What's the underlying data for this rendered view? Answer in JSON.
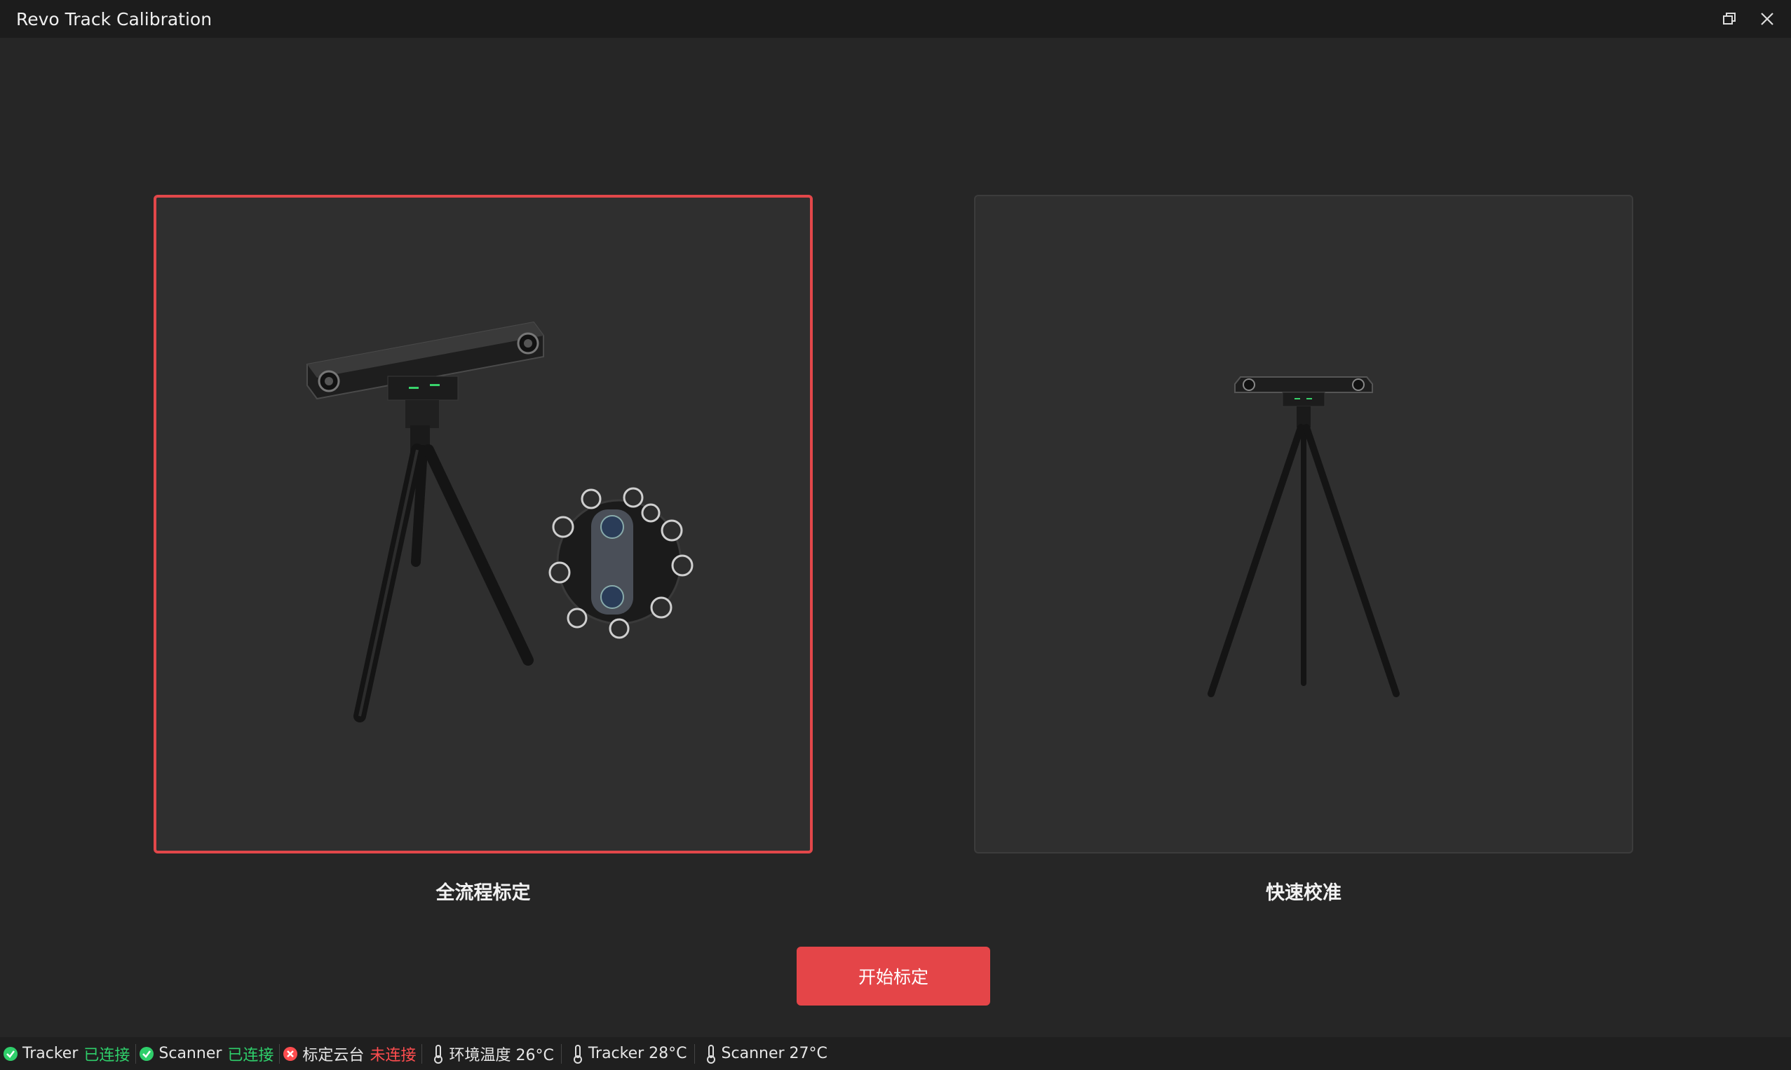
{
  "window": {
    "title": "Revo Track Calibration",
    "restore_icon": "restore-icon",
    "close_icon": "close-icon"
  },
  "cards": [
    {
      "label": "全流程标定",
      "selected": true
    },
    {
      "label": "快速校准",
      "selected": false
    }
  ],
  "start_button": {
    "label": "开始标定"
  },
  "status": {
    "tracker": {
      "name": "Tracker",
      "state": "已连接"
    },
    "scanner": {
      "name": "Scanner",
      "state": "已连接"
    },
    "stage": {
      "name": "标定云台",
      "state": "未连接"
    },
    "env_temp": "环境温度 26°C",
    "tracker_temp": "Tracker 28°C",
    "scanner_temp": "Scanner 27°C"
  },
  "colors": {
    "accent": "#e44548",
    "connected": "#2fcf6b",
    "disconnected": "#ff4d4f"
  }
}
